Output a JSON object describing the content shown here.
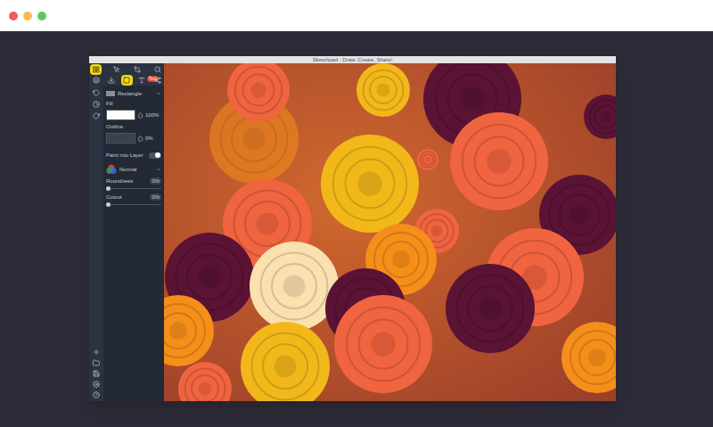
{
  "page_bar": {
    "dots": [
      {
        "color": "#f0605a"
      },
      {
        "color": "#f5bd4f"
      },
      {
        "color": "#5ccb5f"
      }
    ]
  },
  "window": {
    "title": "Sketchpad - Draw, Create, Share!"
  },
  "toolbar": {
    "row1": [
      {
        "selected": true
      },
      {
        "selected": false
      },
      {
        "selected": false
      },
      {
        "selected": false
      }
    ],
    "row2": [
      {
        "selected": false,
        "badge": ""
      },
      {
        "selected": false,
        "badge": ""
      },
      {
        "selected": true,
        "badge": ""
      },
      {
        "selected": false,
        "badge": "Text"
      },
      {
        "selected": false,
        "badge": ""
      }
    ]
  },
  "side_tools": [
    {
      "selected": false
    },
    {
      "selected": false
    },
    {
      "selected": false
    }
  ],
  "shape": {
    "label": "Rectangle"
  },
  "fill": {
    "label": "Fill",
    "opacity": "100%",
    "color": "#ffffff"
  },
  "outline": {
    "label": "Outline",
    "opacity": "0%",
    "color": "#3a4150"
  },
  "paint_into_layer": {
    "label": "Paint into Layer",
    "on": true
  },
  "blend": {
    "label": "Normal"
  },
  "sliders": [
    {
      "label": "Roundness",
      "reading": "0%",
      "level": 0
    },
    {
      "label": "Cutout",
      "reading": "0%",
      "level": 0
    }
  ],
  "bottom_tools": [
    {
      "selected": false
    },
    {
      "selected": false
    },
    {
      "selected": false
    },
    {
      "selected": false
    },
    {
      "selected": false
    }
  ]
}
